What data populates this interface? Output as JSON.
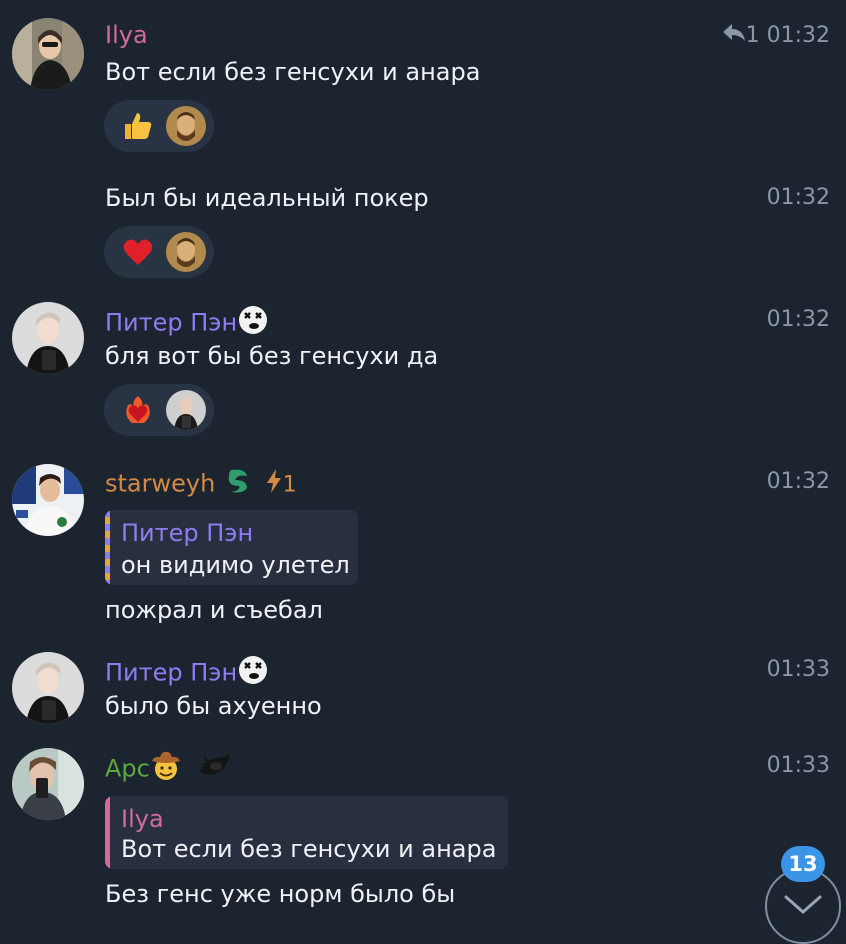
{
  "messages": [
    {
      "sender": "Ilya",
      "sender_color": "#d46a9b",
      "text": "Вот если без генсухи и анара",
      "replies": "1",
      "time": "01:32",
      "reaction": "thumbs-up"
    },
    {
      "text": "Был бы идеальный покер",
      "time": "01:32",
      "reaction": "heart"
    },
    {
      "sender": "Питер Пэн",
      "sender_color": "#8f7cf0",
      "text": "бля вот бы без генсухи да",
      "time": "01:32",
      "reaction": "heart-on-fire"
    },
    {
      "sender": "starweyh",
      "sender_color": "#d38b43",
      "boost": "1",
      "quote": {
        "name": "Питер Пэн",
        "text": "он видимо улетел"
      },
      "text": "пожрал и съебал",
      "time": "01:32"
    },
    {
      "sender": "Питер Пэн",
      "sender_color": "#8f7cf0",
      "text": "было бы ахуенно",
      "time": "01:33"
    },
    {
      "sender": "Арс",
      "sender_color": "#5aa83e",
      "quote": {
        "name": "Ilya",
        "text": "Вот если без генсухи и анара"
      },
      "text": "Без генс уже норм было бы",
      "time": "01:33"
    }
  ],
  "scroll_down": {
    "unread_count": "13"
  },
  "colors": {
    "background": "#1c2430",
    "time": "#8c97a5",
    "badge": "#3b94e6",
    "reaction_pill": "#283444"
  }
}
